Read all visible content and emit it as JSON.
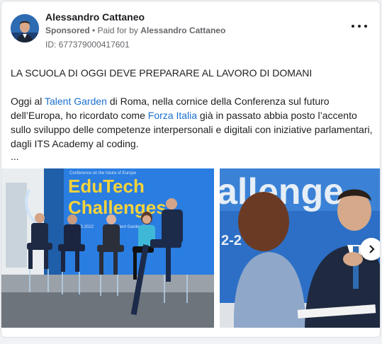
{
  "post": {
    "author": "Alessandro Cattaneo",
    "sponsored": "Sponsored",
    "paid_prefix": "• Paid for by",
    "paid_by": "Alessandro Cattaneo",
    "ad_id": "ID: 677379000417601",
    "more_icon": "more-horizontal-icon",
    "headline": "LA SCUOLA DI OGGI DEVE PREPARARE AL LAVORO DI DOMANI",
    "body_part1": "Oggi al ",
    "link1": "Talent Garden",
    "body_part2": " di Roma, nella cornice della Conferenza sul futuro dell’Europa, ho ricordato come ",
    "link2": "Forza Italia",
    "body_part3": " già in passato abbia posto l’accento sullo sviluppo delle competenze interpersonali e digitali con iniziative parlamentari, dagli ITS Academy al coding.",
    "ellipsis": "...",
    "colors": {
      "link": "#1a6fd1",
      "banner": "#2a7de1",
      "banner_title": "#f5d33a"
    }
  },
  "carousel": {
    "image1": {
      "banner_small": "Conference on the future of Europe",
      "banner_title_1": "EduTech",
      "banner_title_2": "Challenges",
      "banner_date": "18.03.2022",
      "banner_place": "Talent Garden Rome"
    },
    "image2": {
      "banner_text": "allenge",
      "banner_small": "2-2"
    },
    "next_icon": "chevron-right-icon"
  }
}
